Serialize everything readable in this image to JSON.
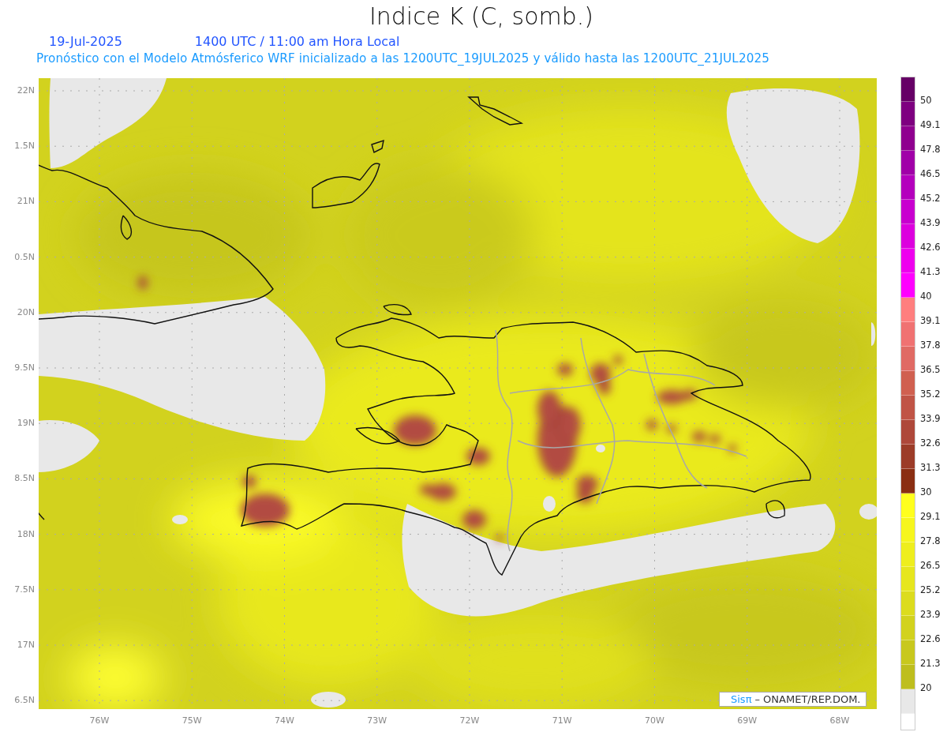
{
  "title": "Indice K (C, somb.)",
  "date": "19-Jul-2025",
  "time": "1400 UTC / 11:00 am Hora Local",
  "subtitle": "Pronóstico con el Modelo Atmósferico WRF inicializado a las 1200UTC_19JUL2025 y válido hasta las  1200UTC_21JUL2025",
  "map": {
    "lat_labels": [
      "22N",
      "1.5N",
      "21N",
      "0.5N",
      "20N",
      "9.5N",
      "19N",
      "8.5N",
      "18N",
      "7.5N",
      "17N",
      "6.5N"
    ],
    "lon_labels": [
      "76W",
      "75W",
      "74W",
      "73W",
      "72W",
      "71W",
      "70W",
      "69W",
      "68W"
    ]
  },
  "credit": {
    "logo": "Sisπ",
    "text": "– ONAMET/REP.DOM."
  },
  "colorbar": [
    {
      "label": "50",
      "color": "#660066"
    },
    {
      "label": "49.1",
      "color": "#7e0080"
    },
    {
      "label": "47.8",
      "color": "#8f008f"
    },
    {
      "label": "46.5",
      "color": "#a000a8"
    },
    {
      "label": "45.2",
      "color": "#b400bd"
    },
    {
      "label": "43.9",
      "color": "#c800cf"
    },
    {
      "label": "42.6",
      "color": "#dc00de"
    },
    {
      "label": "41.3",
      "color": "#ee00ee"
    },
    {
      "label": "40",
      "color": "#ff00ff"
    },
    {
      "label": "39.1",
      "color": "#ff7f7f"
    },
    {
      "label": "37.8",
      "color": "#f07272"
    },
    {
      "label": "36.5",
      "color": "#e06a64"
    },
    {
      "label": "35.2",
      "color": "#d06050"
    },
    {
      "label": "33.9",
      "color": "#c05446"
    },
    {
      "label": "32.6",
      "color": "#ae483a"
    },
    {
      "label": "31.3",
      "color": "#9c3c28"
    },
    {
      "label": "30",
      "color": "#8a2e12"
    },
    {
      "label": "29.1",
      "color": "#ffff1e"
    },
    {
      "label": "27.8",
      "color": "#f6f61e"
    },
    {
      "label": "26.5",
      "color": "#eeee1e"
    },
    {
      "label": "25.2",
      "color": "#e6e61e"
    },
    {
      "label": "23.9",
      "color": "#dcdc1e"
    },
    {
      "label": "22.6",
      "color": "#d2d21e"
    },
    {
      "label": "21.3",
      "color": "#c8c81e"
    },
    {
      "label": "20",
      "color": "#bebe1e"
    },
    {
      "color": "#e8e8e8"
    }
  ]
}
